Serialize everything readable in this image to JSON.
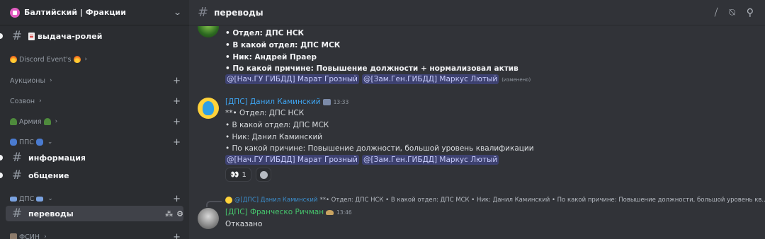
{
  "server": {
    "name": "Балтийский | Фракции"
  },
  "channel": {
    "name": "переводы"
  },
  "sidebar": {
    "roles_channel": "выдача-ролей",
    "cat_events": "Discord Event's",
    "cat_auctions": "Аукционы",
    "cat_call": "Созвон",
    "cat_army": "Армия",
    "cat_pps": "ППС",
    "ch_info": "информация",
    "ch_chat": "общение",
    "cat_dps": "ДПС",
    "ch_transfers": "переводы",
    "cat_fsin": "ФСИН"
  },
  "messages": {
    "m1": {
      "l1": "• Отдел: ДПС НСК",
      "l2": "• В какой отдел: ДПС МСК",
      "l3": "• Ник: Андрей Праер",
      "l4": "• По какой причине: Повышение должности + нормализовал актив",
      "mention1": "@[Нач.ГУ ГИБДД] Марат Грозный",
      "mention2": "@[Зам.Ген.ГИБДД] Маркус Лютый",
      "edited": "(изменено)"
    },
    "m2": {
      "author": "[ДПС] Данил Каминский",
      "time": "13:33",
      "l1": "**• Отдел: ДПС НСК",
      "l2": "• В какой отдел: ДПС МСК",
      "l3": "• Ник: Данил Каминский",
      "l4": "• По какой причине: Повышение должности, большой уровень квалификации",
      "mention1": "@[Нач.ГУ ГИБДД] Марат Грозный",
      "mention2": "@[Зам.Ген.ГИБДД] Маркус Лютый",
      "reaction_count": "1"
    },
    "m3": {
      "reply_author": "@[ДПС] Данил Каминский",
      "reply_text": "**• Отдел: ДПС НСК • В какой отдел: ДПС МСК • Ник: Данил Каминский  • По какой причине: Повышение должности, большой уровень кв...",
      "author": "[ДПС] Франческо Ричман",
      "time": "13:46",
      "text": "Отказано"
    }
  },
  "icons": {
    "hash": "#",
    "chevron": "›",
    "chevron_down": "⌄",
    "plus": "+",
    "eyes": "👀"
  },
  "colors": {
    "background": "#313338",
    "sidebar": "#2b2d31",
    "mention_bg": "#3b3f75",
    "author_blue": "#3ea4f0",
    "author_green": "#46c46c"
  }
}
